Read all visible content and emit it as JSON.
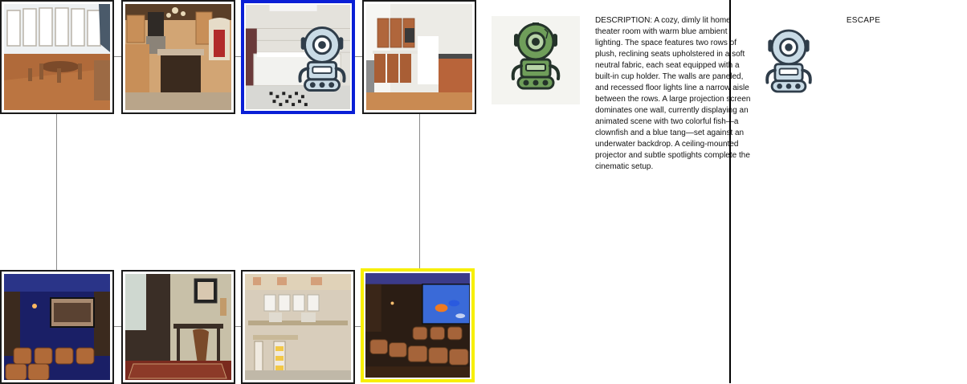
{
  "description": {
    "text": "DESCRIPTION: A cozy, dimly lit home theater room with warm blue ambient lighting. The space features two rows of plush, reclining seats upholstered in a soft neutral fabric, each seat equipped with a built-in cup holder. The walls are paneled, and recessed floor lights line a narrow aisle between the rows. A large projection screen dominates one wall, currently displaying an animated scene with two colorful fish—a clownfish and a blue tang—set against an underwater backdrop. A ceiling-mounted projector and subtle spotlights complete the cinematic setup."
  },
  "escape": {
    "label": "ESCAPE"
  },
  "colors": {
    "selected_current": "#0a1fd6",
    "selected_target": "#f7ef00",
    "robot_green": "#6f9e5a",
    "robot_blue": "#c9dbe6"
  },
  "rooms": [
    {
      "id": "room-bay-window-dining",
      "scene": "bay-window-dining"
    },
    {
      "id": "room-wood-kitchen",
      "scene": "wood-kitchen"
    },
    {
      "id": "room-bathroom",
      "scene": "bathroom",
      "state": "current"
    },
    {
      "id": "room-modern-kitchen",
      "scene": "modern-kitchen"
    },
    {
      "id": "room-home-theater-1",
      "scene": "home-theater"
    },
    {
      "id": "room-study",
      "scene": "study"
    },
    {
      "id": "room-craft-room",
      "scene": "craft-room"
    },
    {
      "id": "room-home-theater-2",
      "scene": "home-theater-fish",
      "state": "target"
    }
  ],
  "icons": {
    "agent": "robot-green-icon",
    "player": "robot-blue-icon",
    "escape": "robot-blue-icon"
  }
}
